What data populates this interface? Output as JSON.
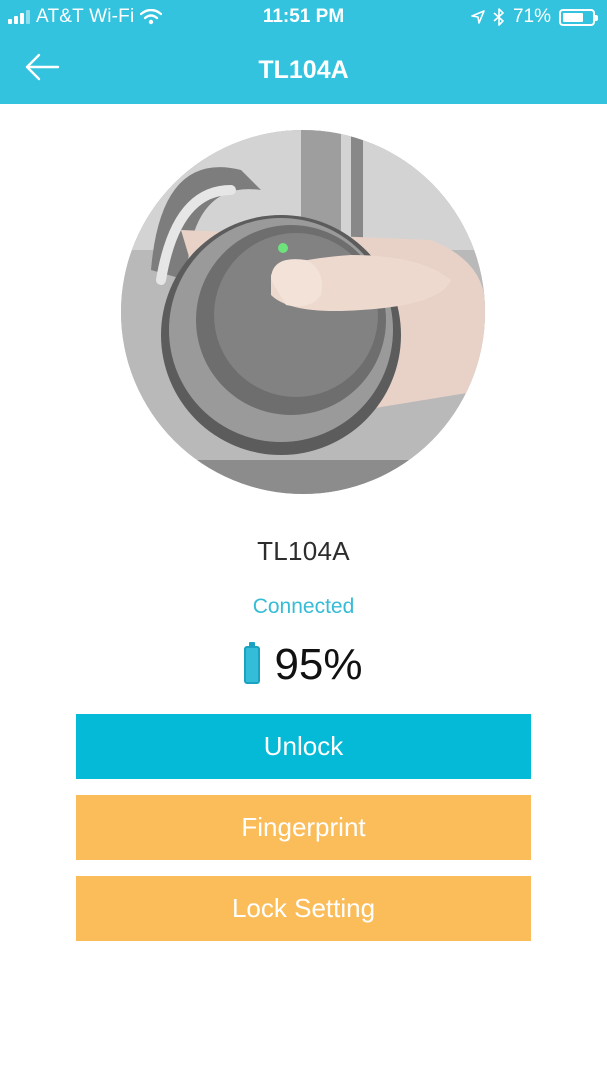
{
  "status_bar": {
    "carrier": "AT&T Wi-Fi",
    "time": "11:51 PM",
    "battery_percent": "71%",
    "icons": [
      "signal-icon",
      "wifi-icon",
      "location-icon",
      "bluetooth-icon",
      "battery-icon"
    ]
  },
  "header": {
    "title": "TL104A",
    "back_icon": "back-arrow-icon"
  },
  "device": {
    "name": "TL104A",
    "connection_status": "Connected",
    "battery_level": "95%"
  },
  "actions": {
    "unlock_label": "Unlock",
    "fingerprint_label": "Fingerprint",
    "lock_setting_label": "Lock Setting"
  },
  "colors": {
    "header": "#33c3de",
    "primary_button": "#04bad6",
    "secondary_button": "#fbbd5a",
    "status_text": "#35bcd6"
  }
}
